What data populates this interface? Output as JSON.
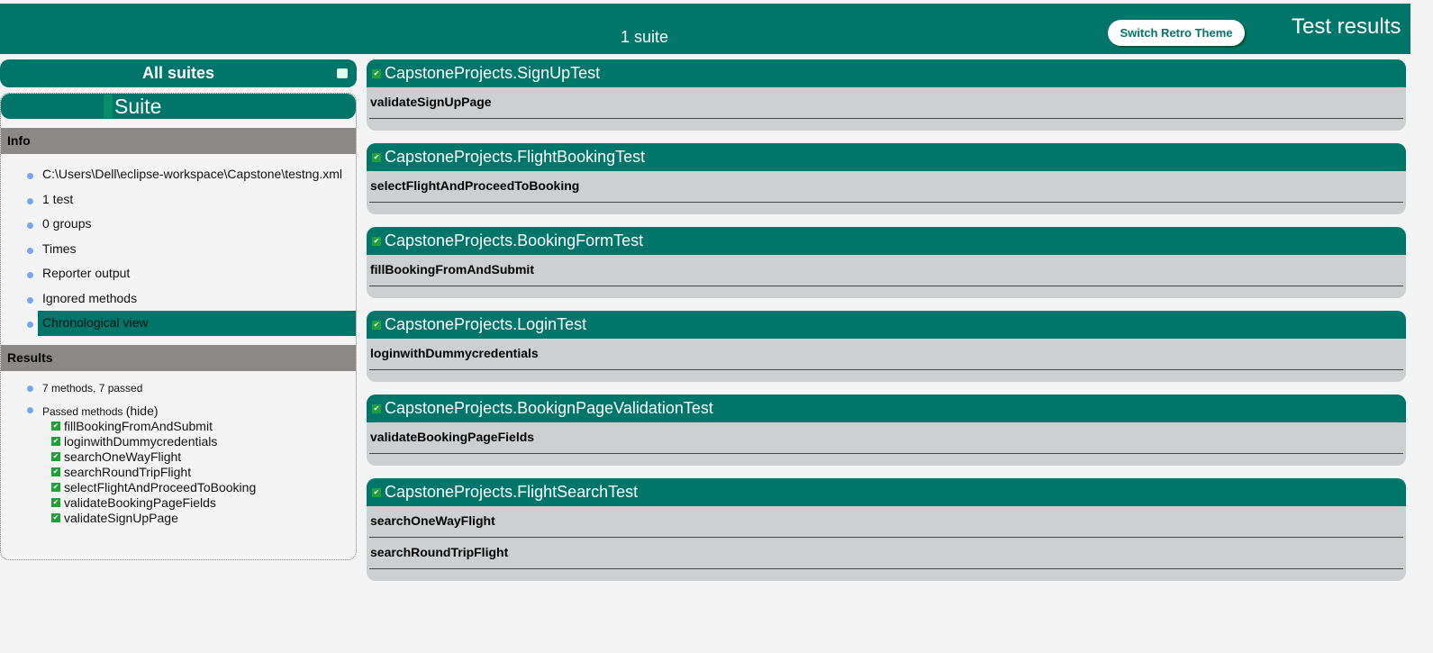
{
  "header": {
    "suite_count": "1 suite",
    "theme_button": "Switch Retro Theme",
    "title": "Test results"
  },
  "sidebar": {
    "all_suites": "All suites",
    "suite_name": "Suite",
    "info_title": "Info",
    "info_items": [
      "C:\\Users\\Dell\\eclipse-workspace\\Capstone\\testng.xml",
      "1 test",
      "0 groups",
      "Times",
      "Reporter output",
      "Ignored methods",
      "Chronological view"
    ],
    "results_title": "Results",
    "summary": "7 methods, 7 passed",
    "passed_label": "Passed methods ",
    "hide": "(hide)",
    "passed_methods": [
      "fillBookingFromAndSubmit",
      "loginwithDummycredentials",
      "searchOneWayFlight",
      "searchRoundTripFlight",
      "selectFlightAndProceedToBooking",
      "validateBookingPageFields",
      "validateSignUpPage"
    ]
  },
  "classes": [
    {
      "name": "CapstoneProjects.SignUpTest",
      "methods": [
        "validateSignUpPage"
      ]
    },
    {
      "name": "CapstoneProjects.FlightBookingTest",
      "methods": [
        "selectFlightAndProceedToBooking"
      ]
    },
    {
      "name": "CapstoneProjects.BookingFormTest",
      "methods": [
        "fillBookingFromAndSubmit"
      ]
    },
    {
      "name": "CapstoneProjects.LoginTest",
      "methods": [
        "loginwithDummycredentials"
      ]
    },
    {
      "name": "CapstoneProjects.BookignPageValidationTest",
      "methods": [
        "validateBookingPageFields"
      ]
    },
    {
      "name": "CapstoneProjects.FlightSearchTest",
      "methods": [
        "searchOneWayFlight",
        "searchRoundTripFlight"
      ]
    }
  ],
  "colors": {
    "brand": "#00756a",
    "section": "#8c8888",
    "pass": "#1fa03a"
  }
}
